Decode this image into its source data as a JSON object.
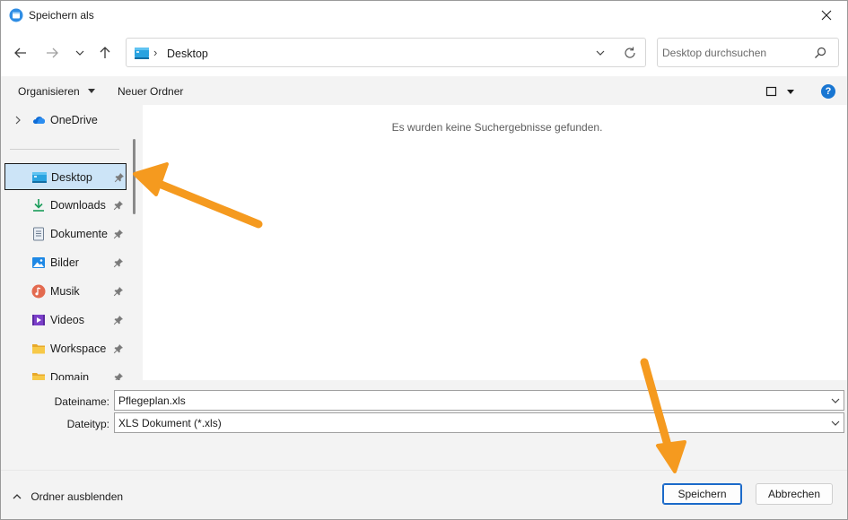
{
  "window": {
    "title": "Speichern als",
    "close_label": "Schließen"
  },
  "nav": {
    "address_path": "Desktop",
    "search_placeholder": "Desktop durchsuchen"
  },
  "toolbar": {
    "organize_label": "Organisieren",
    "new_folder_label": "Neuer Ordner",
    "help_label": "?"
  },
  "sidebar": {
    "onedrive_label": "OneDrive",
    "items": [
      {
        "label": "Desktop",
        "icon": "desktop-icon",
        "selected": true
      },
      {
        "label": "Downloads",
        "icon": "download-icon"
      },
      {
        "label": "Dokumente",
        "icon": "document-icon"
      },
      {
        "label": "Bilder",
        "icon": "pictures-icon"
      },
      {
        "label": "Musik",
        "icon": "music-icon"
      },
      {
        "label": "Videos",
        "icon": "videos-icon"
      },
      {
        "label": "Workspace",
        "icon": "folder-icon"
      },
      {
        "label": "Domain",
        "icon": "folder-icon"
      }
    ]
  },
  "content": {
    "empty_message": "Es wurden keine Suchergebnisse gefunden."
  },
  "fields": {
    "filename_label": "Dateiname:",
    "filename_value": "Pflegeplan.xls",
    "filetype_label": "Dateityp:",
    "filetype_value": "XLS Dokument (*.xls)"
  },
  "footer": {
    "hide_folders_label": "Ordner ausblenden",
    "save_label": "Speichern",
    "cancel_label": "Abbrechen"
  },
  "colors": {
    "accent": "#1b6ac9",
    "selection": "#cce4f7",
    "annotation_arrow": "#f59a1f"
  }
}
